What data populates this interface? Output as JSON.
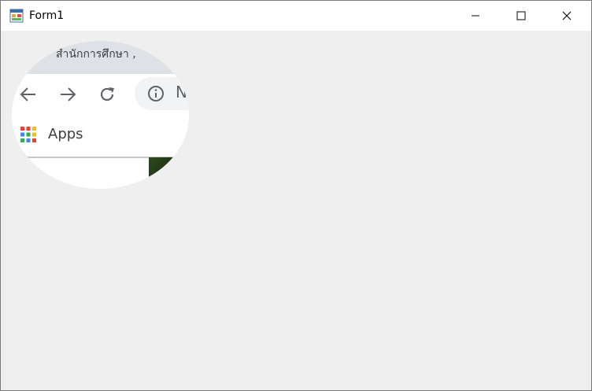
{
  "window": {
    "title": "Form1",
    "icon": "winforms-app-icon",
    "controls": [
      "minimize-icon",
      "maximize-icon",
      "close-icon"
    ]
  },
  "picture": {
    "tab_text": "สำนักการศึกษา ,",
    "nav_icons": [
      "back-arrow-icon",
      "forward-arrow-icon",
      "reload-icon",
      "info-icon"
    ],
    "omnibox_text": "N",
    "bookmark_label": "Apps",
    "colors": {
      "tabstrip": "#dee1e6",
      "omnibox": "#f1f3f4",
      "icon_gray": "#5f6368"
    }
  }
}
